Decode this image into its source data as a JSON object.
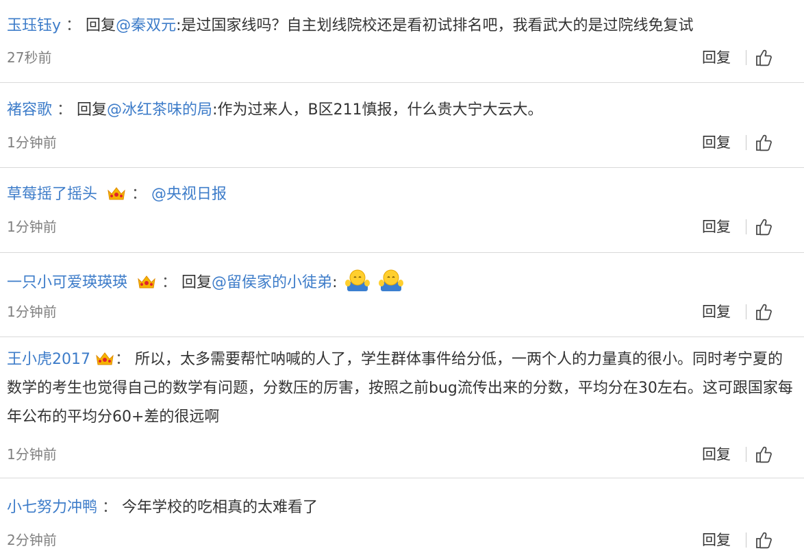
{
  "actions": {
    "reply_label": "回复"
  },
  "comments": [
    {
      "user": "玉珏钰y",
      "sep": "：",
      "reply_prefix": "回复",
      "mention": "@秦双元",
      "text": ":是过国家线吗？自主划线院校还是看初试排名吧，我看武大的是过院线免复试",
      "time": "27秒前"
    },
    {
      "user": "褚容歌",
      "sep": "：",
      "reply_prefix": "回复",
      "mention": "@冰红茶味的局",
      "text": ":作为过来人，B区211慎报，什么贵大宁大云大。",
      "time": "1分钟前"
    },
    {
      "user": "草莓摇了摇头",
      "sep": "：",
      "mention": "@央视日报",
      "time": "1分钟前"
    },
    {
      "user": "一只小可爱瑛瑛瑛",
      "sep": "：",
      "reply_prefix": "回复",
      "mention": "@留侯家的小徒弟",
      "text": ":",
      "time": "1分钟前"
    },
    {
      "user": "王小虎2017",
      "sep": "：",
      "text": "所以，太多需要帮忙呐喊的人了，学生群体事件给分低，一两个人的力量真的很小。同时考宁夏的数学的考生也觉得自己的数学有问题，分数压的厉害，按照之前bug流传出来的分数，平均分在30左右。这可跟国家每年公布的平均分60+差的很远啊",
      "time": "1分钟前"
    },
    {
      "user": "小七努力冲鸭",
      "sep": "：",
      "text": "今年学校的吃相真的太难看了",
      "time": "2分钟前"
    }
  ]
}
